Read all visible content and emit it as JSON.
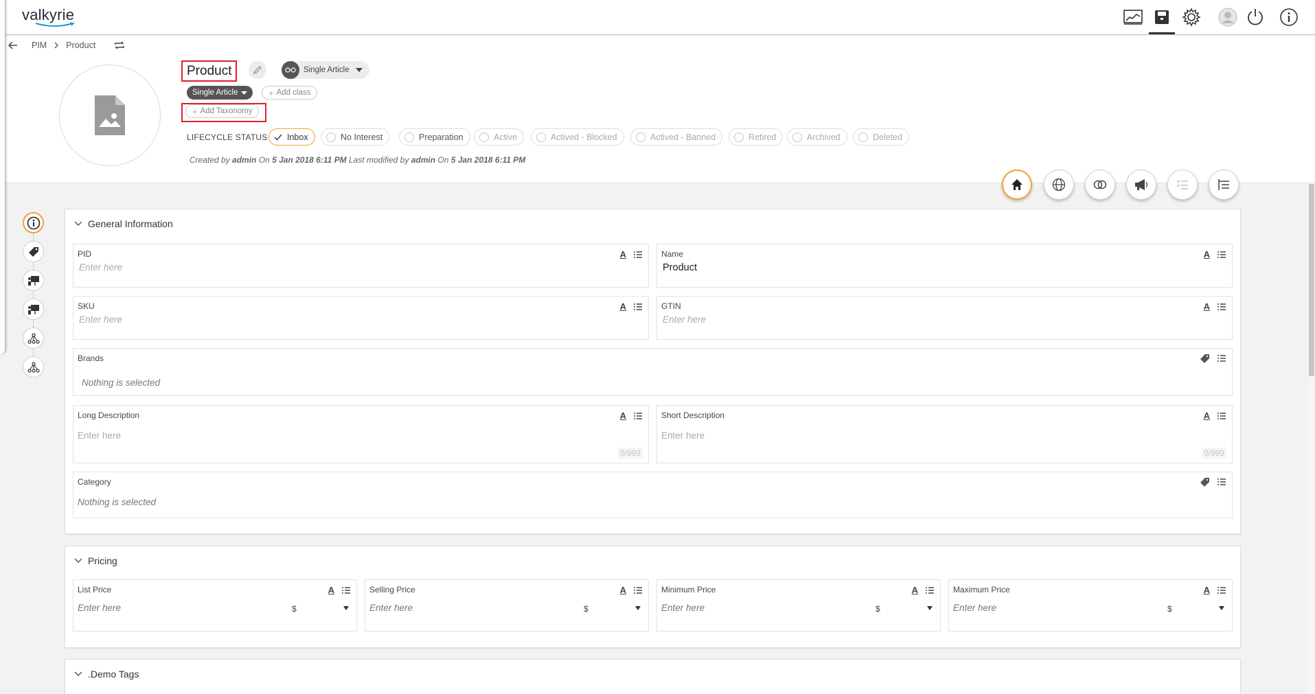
{
  "app": {
    "logo_text": "valkyrie"
  },
  "topbar": {
    "icons": [
      "dashboard-chart-icon",
      "archive-box-icon",
      "settings-gear-icon",
      "user-avatar-icon",
      "power-icon",
      "info-icon"
    ]
  },
  "breadcrumb": {
    "items": [
      "PIM",
      "Product"
    ]
  },
  "product": {
    "title": "Product",
    "type_label": "Single Article",
    "class_label": "Single Article",
    "add_class": "Add class",
    "add_taxonomy": "Add Taxonomy"
  },
  "lifecycle": {
    "label": "LIFECYCLE STATUS",
    "states": [
      "Inbox",
      "No Interest",
      "Preparation",
      "Active",
      "Actived - Blocked",
      "Actived - Banned",
      "Retired",
      "Archived",
      "Deleted"
    ],
    "selected": "Inbox"
  },
  "meta": {
    "created_prefix": "Created by",
    "created_by": "admin",
    "on": "On",
    "created_on": "5 Jan 2018 6:11 PM",
    "modified_prefix": "Last modified by",
    "modified_by": "admin",
    "modified_on": "5 Jan 2018 6:11 PM"
  },
  "tabs": [
    "home-icon",
    "globe-icon",
    "links-icon",
    "megaphone-icon",
    "checklist-icon",
    "hierarchy-list-icon"
  ],
  "general": {
    "title": "General Information",
    "pid": {
      "label": "PID",
      "placeholder": "Enter here"
    },
    "name": {
      "label": "Name",
      "value": "Product"
    },
    "sku": {
      "label": "SKU",
      "placeholder": "Enter here"
    },
    "gtin": {
      "label": "GTIN",
      "placeholder": "Enter here"
    },
    "brands": {
      "label": "Brands",
      "placeholder": "Nothing is selected"
    },
    "long_desc": {
      "label": "Long Description",
      "placeholder": "Enter here",
      "counter": "0/999"
    },
    "short_desc": {
      "label": "Short Description",
      "placeholder": "Enter here",
      "counter": "0/999"
    },
    "category": {
      "label": "Category",
      "placeholder": "Nothing is selected"
    }
  },
  "pricing": {
    "title": "Pricing",
    "fields": [
      {
        "label": "List Price",
        "placeholder": "Enter here",
        "currency": "$"
      },
      {
        "label": "Selling Price",
        "placeholder": "Enter here",
        "currency": "$"
      },
      {
        "label": "Minimum Price",
        "placeholder": "Enter here",
        "currency": "$"
      },
      {
        "label": "Maximum Price",
        "placeholder": "Enter here",
        "currency": "$"
      }
    ]
  },
  "demo_tags": {
    "title": ".Demo Tags"
  },
  "colors": {
    "accent": "#f0a33a",
    "highlight": "#e0202a"
  }
}
